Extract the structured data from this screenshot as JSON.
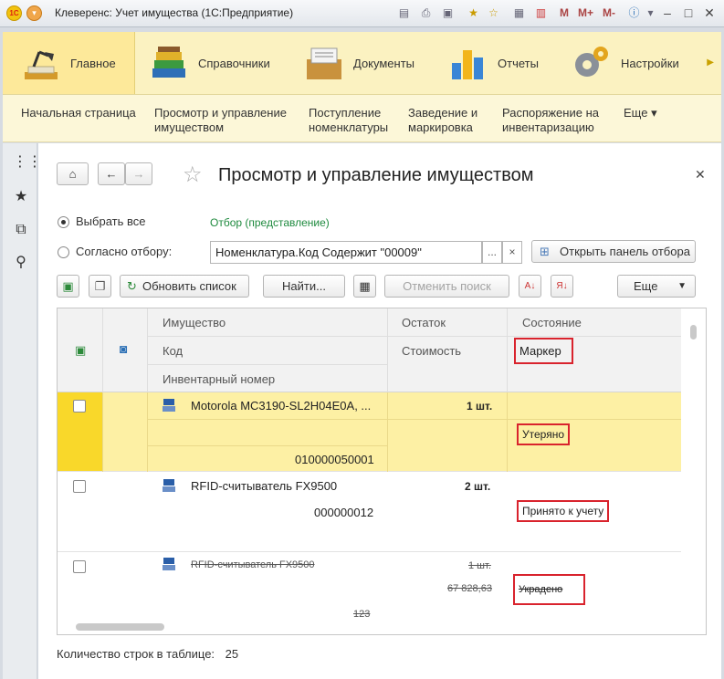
{
  "window": {
    "title": "Клеверенс: Учет имущества  (1С:Предприятие)",
    "logo_text": "1С",
    "m_buttons": [
      "M",
      "M+",
      "M-"
    ]
  },
  "sections": [
    {
      "label": "Главное",
      "icon": "desk-lamp-icon"
    },
    {
      "label": "Справочники",
      "icon": "books-icon"
    },
    {
      "label": "Документы",
      "icon": "documents-box-icon"
    },
    {
      "label": "Отчеты",
      "icon": "bar-chart-icon"
    },
    {
      "label": "Настройки",
      "icon": "gears-icon"
    }
  ],
  "commands": [
    {
      "line1": "Начальная страница",
      "line2": ""
    },
    {
      "line1": "Просмотр и управление",
      "line2": "имуществом"
    },
    {
      "line1": "Поступление",
      "line2": "номенклатуры"
    },
    {
      "line1": "Заведение и",
      "line2": "маркировка"
    },
    {
      "line1": "Распоряжение на",
      "line2": "инвентаризацию"
    },
    {
      "line1": "Еще ▾",
      "line2": ""
    }
  ],
  "form": {
    "title": "Просмотр и управление имуществом",
    "radio_all": "Выбрать все",
    "radio_filter": "Согласно отбору:",
    "filter_caption": "Отбор (представление)",
    "filter_value": "Номенклатура.Код Содержит \"00009\"",
    "filter_dots": "...",
    "filter_clear": "×",
    "open_filter_panel": "Открыть панель отбора",
    "refresh_list": "Обновить список",
    "find": "Найти...",
    "cancel_search": "Отменить поиск",
    "more": "Еще",
    "footer_label": "Количество строк в таблице:",
    "footer_count": "25"
  },
  "table": {
    "columns": {
      "property": "Имущество",
      "code": "Код",
      "inventory_number": "Инвентарный номер",
      "balance": "Остаток",
      "cost": "Стоимость",
      "state": "Состояние",
      "marker": "Маркер"
    },
    "rows": [
      {
        "name": "Motorola MC3190-SL2H04E0A, ...",
        "code": "",
        "inventory": "010000050001",
        "balance": "1 шт.",
        "cost": "",
        "state": "",
        "marker": "Утеряно",
        "selected": true,
        "struck": false
      },
      {
        "name": "RFID-считыватель FX9500",
        "code": "000000012",
        "inventory": "",
        "balance": "2 шт.",
        "cost": "",
        "state": "",
        "marker": "Принято к учету",
        "selected": false,
        "struck": false
      },
      {
        "name": "RFID-считыватель FX9500",
        "code": "",
        "inventory": "123",
        "balance": "1 шт.",
        "cost": "67 828,63",
        "state": "",
        "marker": "Украдено",
        "selected": false,
        "struck": true
      }
    ]
  },
  "colors": {
    "section_bar": "#fbf2c1",
    "selected_row": "#fdf0a4",
    "highlight_box": "#d9232d",
    "filter_link": "#1e8a3e"
  }
}
